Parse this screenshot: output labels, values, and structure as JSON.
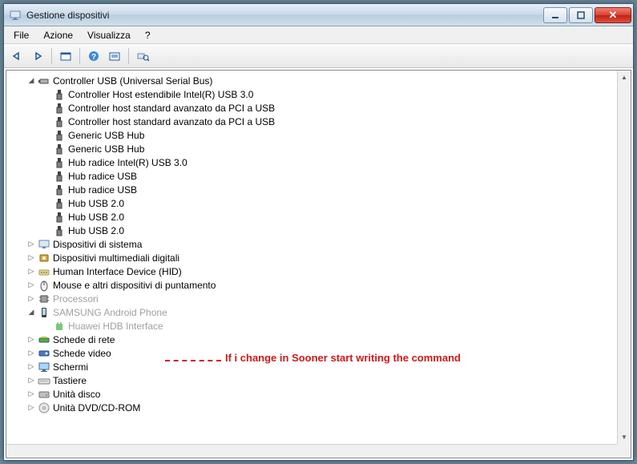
{
  "window": {
    "title": "Gestione dispositivi"
  },
  "menu": {
    "file": "File",
    "action": "Azione",
    "view": "Visualizza",
    "help": "?"
  },
  "toolbar": {
    "back": "←",
    "forward": "→",
    "show_hidden": "⊞",
    "help": "?",
    "properties": "⊡",
    "scan": "⟳"
  },
  "tree": {
    "usb_controller": {
      "label": "Controller USB (Universal Serial Bus)",
      "expanded": true,
      "children": [
        "Controller Host estendibile Intel(R) USB 3.0",
        "Controller host standard avanzato da PCI a USB",
        "Controller host standard avanzato da PCI a USB",
        "Generic USB Hub",
        "Generic USB Hub",
        "Hub radice Intel(R) USB 3.0",
        "Hub radice USB",
        "Hub radice USB",
        "Hub USB 2.0",
        "Hub USB 2.0",
        "Hub USB 2.0"
      ]
    },
    "system_devices": {
      "label": "Dispositivi di sistema"
    },
    "multimedia": {
      "label": "Dispositivi multimediali digitali"
    },
    "hid": {
      "label": "Human Interface Device (HID)"
    },
    "mouse": {
      "label": "Mouse e altri dispositivi di puntamento"
    },
    "processors": {
      "label": "Processori"
    },
    "samsung": {
      "label": "SAMSUNG Android Phone",
      "expanded": true,
      "child": "Huawei HDB Interface"
    },
    "network": {
      "label": "Schede di rete"
    },
    "video": {
      "label": "Schede video"
    },
    "monitors": {
      "label": "Schermi"
    },
    "keyboards": {
      "label": "Tastiere"
    },
    "disk": {
      "label": "Unità disco"
    },
    "dvd": {
      "label": "Unità DVD/CD-ROM"
    }
  },
  "annotation": {
    "text": "If i change in Sooner start writing the command"
  }
}
